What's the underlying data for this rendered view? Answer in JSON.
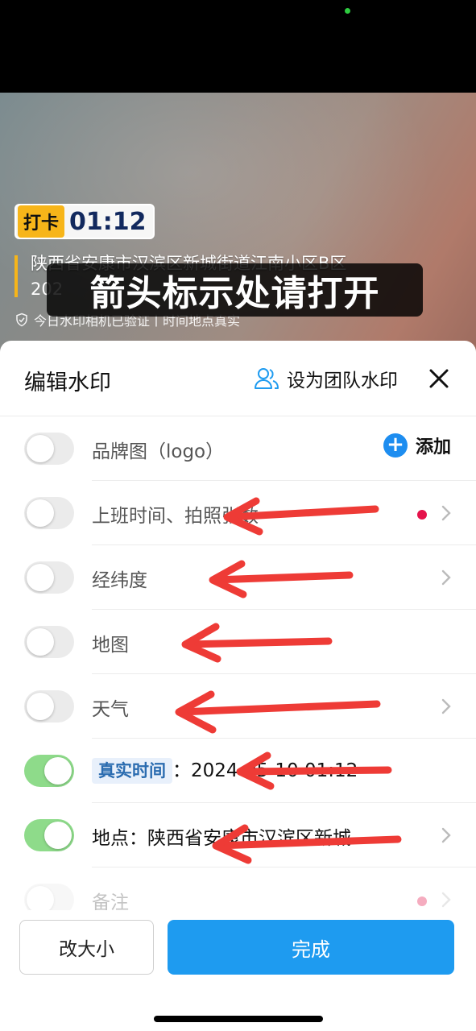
{
  "preview": {
    "tag": "打卡",
    "time": "01:12",
    "address": "陕西省安康市汉滨区新城街道江南小区B区",
    "date_partial": "202",
    "verify_text": "今日水印相机已验证丨时间地点真实",
    "caption": "箭头标示处请打开"
  },
  "sheet": {
    "title": "编辑水印",
    "team_label": "设为团队水印",
    "rows": [
      {
        "label": "品牌图（logo）",
        "on": false,
        "action": "添加"
      },
      {
        "label": "上班时间、拍照张数",
        "on": false,
        "red_dot": true,
        "chevron": true
      },
      {
        "label": "经纬度",
        "on": false,
        "chevron": true
      },
      {
        "label": "地图",
        "on": false
      },
      {
        "label": "天气",
        "on": false,
        "chevron": true
      },
      {
        "tag": "真实时间",
        "value": "：2024-05-10 01:12",
        "on": true
      },
      {
        "label": "地点：陕西省安康市汉滨区新城",
        "on": true,
        "chevron": true
      },
      {
        "label": "备注",
        "on": false,
        "red_dot": true,
        "chevron": true
      }
    ]
  },
  "footer": {
    "resize_label": "改大小",
    "done_label": "完成"
  },
  "colors": {
    "accent_blue": "#1e9bf0",
    "toggle_on": "#8edb8a",
    "badge_yellow": "#f7b519",
    "arrow_red": "#ee3b36"
  }
}
